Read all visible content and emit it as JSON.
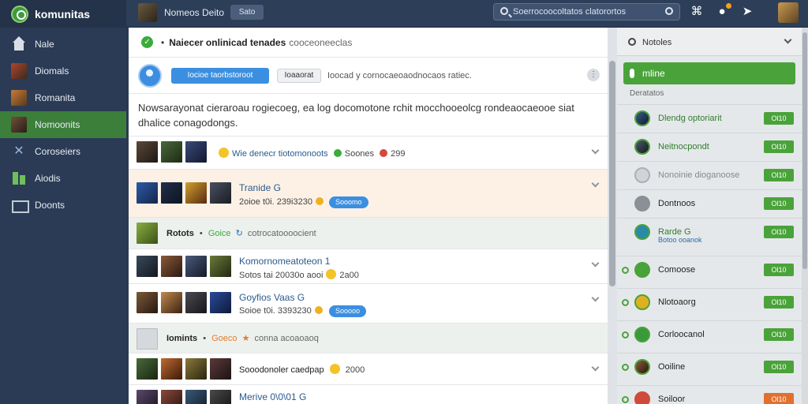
{
  "app": {
    "brand": "komunitas",
    "page_title": "Nomeos Deito",
    "top_pill": "Sato",
    "search_placeholder": "Soerrocoocoltatos clatorortos"
  },
  "sidebar": {
    "items": [
      {
        "label": "Nale",
        "icon": "home-icon"
      },
      {
        "label": "Diomals",
        "icon": "game-icon"
      },
      {
        "label": "Romanita",
        "icon": "community-icon"
      },
      {
        "label": "Nomoonits",
        "icon": "group-icon",
        "active": true
      },
      {
        "label": "Coroseiers",
        "icon": "tools-icon"
      },
      {
        "label": "Aiodis",
        "icon": "stats-icon"
      },
      {
        "label": "Doonts",
        "icon": "mail-icon"
      }
    ]
  },
  "feed": {
    "notice_bold": "Naiecer onlinicad tenades",
    "notice_text": "cooceoneeclas",
    "composer_primary": "Iocioe taorbstoroot",
    "composer_secondary": "Ioaaorat",
    "composer_hint": "Ioocad y cornocaeoaodnocaos ratiec.",
    "description": "Nowsarayonat cieraroau rogiecoeg, ea log docomotone rchit mocchooeolcg rondeaocaeooe siat dhalice conagodongs.",
    "rows": [
      {
        "type": "inline",
        "text": "Wie denecr tiotomonoots",
        "meta1": "Soones",
        "meta2": "299"
      },
      {
        "type": "game",
        "title": "Tranide G",
        "sub": "2oioe t0i. 239i3230",
        "pill": "Sooomo",
        "tinted": true
      },
      {
        "type": "group",
        "title": "Rotots",
        "tag": "Goice",
        "text": "cotrocatoooocient"
      },
      {
        "type": "game2",
        "title": "Komornomeatoteon 1",
        "sub": "Sotos tai 20030o aooi",
        "count": "2a00"
      },
      {
        "type": "game",
        "title": "Goyfios Vaas G",
        "sub": "Soioe t0i. 3393230",
        "pill": "Sooooo"
      },
      {
        "type": "group",
        "title": "Iomints",
        "tag": "Goeco",
        "text": "conna acoaoaoq"
      },
      {
        "type": "game2",
        "title": "Sooodonoler caedpap",
        "sub": "",
        "count": "2000"
      },
      {
        "type": "game",
        "title": "Merive 0\\0\\01 G",
        "sub": "",
        "pill": ""
      }
    ]
  },
  "friends_panel": {
    "title": "Notoles",
    "online_label": "mline",
    "section": "Deratatos",
    "friends": [
      {
        "name": "Dlendg optoriarit",
        "state": "online",
        "btn": "Ol10"
      },
      {
        "name": "Neitnocpondt",
        "state": "online",
        "btn": "Ol10"
      },
      {
        "name": "Nonoinie dioganoose",
        "state": "muted",
        "btn": "Ol10"
      },
      {
        "name": "Dontnoos",
        "state": "default",
        "btn": "Ol10"
      },
      {
        "name": "Rarde G",
        "sub": "Botoo ooanok",
        "state": "online",
        "btn": "Ol10"
      },
      {
        "name": "Comoose",
        "state": "default",
        "btn": "Ol10"
      },
      {
        "name": "Nlotoaorg",
        "state": "default",
        "btn": "Ol10"
      },
      {
        "name": "Corloocanol",
        "state": "online",
        "btn": "Ol10"
      },
      {
        "name": "Ooiline",
        "state": "default",
        "btn": "Ol10"
      },
      {
        "name": "Soiloor",
        "state": "default",
        "btn": "Ol10",
        "orange": true
      }
    ]
  },
  "colors": {
    "accent_green": "#4aa33a",
    "accent_blue": "#3b8fe0",
    "nav_active": "#3b7f3b"
  }
}
